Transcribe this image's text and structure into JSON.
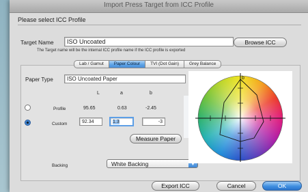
{
  "window": {
    "title": "Import Press Target from ICC Profile"
  },
  "header": {
    "prompt": "Please select ICC Profile"
  },
  "target": {
    "label": "Target Name",
    "value": "ISO Uncoated",
    "browse_label": "Browse ICC",
    "note": "The Target name will be the internal ICC profile name if the ICC profile is exported"
  },
  "tabs": [
    {
      "label": "Lab / Gamut"
    },
    {
      "label": "Paper Colour",
      "active": true
    },
    {
      "label": "TVI (Dot Gain)"
    },
    {
      "label": "Grey Balance"
    }
  ],
  "paper": {
    "type_label": "Paper Type",
    "type_value": "ISO Uncoated Paper",
    "col_l": "L",
    "col_a": "a",
    "col_b": "b",
    "profile_label": "Profile",
    "profile_l": "95.65",
    "profile_a": "0.63",
    "profile_b": "-2.45",
    "custom_label": "Custom",
    "custom_l": "92.34",
    "custom_a": "1.3",
    "custom_b": "-3",
    "selected": "custom",
    "measure_label": "Measure Paper"
  },
  "backing": {
    "label": "Backing",
    "value": "White Backing"
  },
  "gamut": {
    "axis_label": "b"
  },
  "footer": {
    "export_label": "Export ICC",
    "cancel_label": "Cancel",
    "ok_label": "OK"
  },
  "colors": {
    "accent": "#3f8fe0",
    "dialog_bg": "#dcdcdc",
    "desktop_bg": "#9ab8c4"
  }
}
